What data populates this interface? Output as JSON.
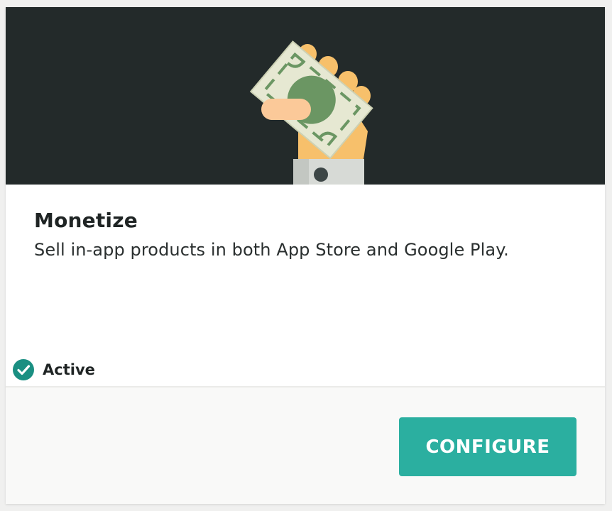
{
  "card": {
    "title": "Monetize",
    "description": "Sell in-app products in both App Store and Google Play.",
    "status_label": "Active",
    "configure_label": "CONFIGURE"
  },
  "icons": {
    "hero": "hand-holding-money-icon",
    "status": "check-circle-icon"
  },
  "colors": {
    "hero_background": "#232a2a",
    "accent": "#2bafa0",
    "status_check": "#1a8f82",
    "footer_background": "#f9f9f8"
  }
}
